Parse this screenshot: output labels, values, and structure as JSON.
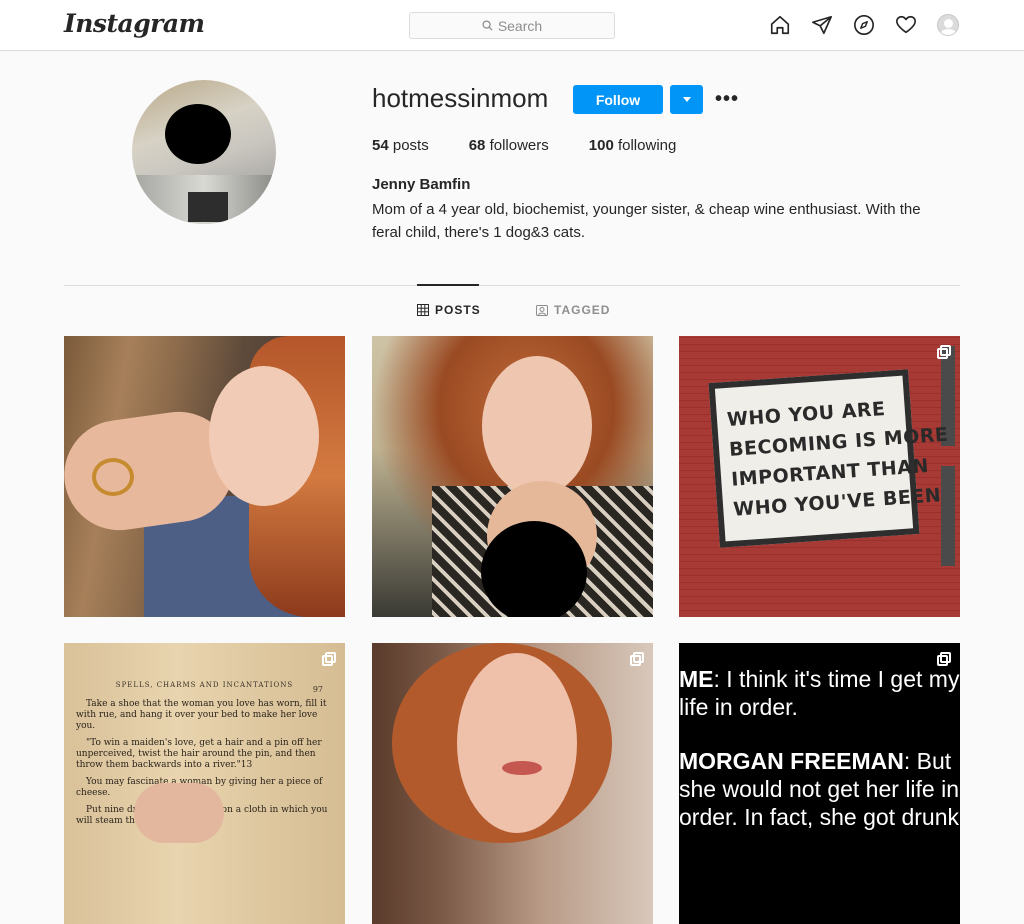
{
  "header": {
    "logo": "Instagram",
    "search_placeholder": "Search",
    "nav_icons": [
      "home-icon",
      "direct-icon",
      "explore-icon",
      "activity-heart-icon",
      "profile-avatar"
    ]
  },
  "profile": {
    "username": "hotmessinmom",
    "follow_label": "Follow",
    "more_label": "•••",
    "stats": {
      "posts_count": "54",
      "posts_label": "posts",
      "followers_count": "68",
      "followers_label": "followers",
      "following_count": "100",
      "following_label": "following"
    },
    "full_name": "Jenny Bamfin",
    "bio": "Mom of a 4 year old, biochemist, younger sister, & cheap wine enthusiast. With the feral child, there's 1 dog&3 cats."
  },
  "tabs": {
    "posts": "POSTS",
    "tagged": "TAGGED"
  },
  "posts": {
    "sign_lines": [
      "WHO  YOU  ARE",
      "BECOMING IS MORE",
      "IMPORTANT  THAN",
      "WHO YOU'VE BEEN"
    ],
    "book_header": "SPELLS, CHARMS AND INCANTATIONS",
    "book_page": "97",
    "book_paragraphs": [
      "Take a shoe that the woman you love has worn, fill it with rue, and hang it over your bed to make her love you.",
      "\"To win a maiden's love, get a hair and a pin off her unperceived, twist the hair around the pin, and then throw them backwards into a river.\"13",
      "You may fascinate a woman by giving her a piece of cheese.",
      "Put nine drops of fresh blood on a cloth in which you will steam the ... you love."
    ],
    "meme_line1_bold": "ME",
    "meme_line1_rest": ": I think it's time I get my life in order.",
    "meme_line2_bold": "MORGAN FREEMAN",
    "meme_line2_rest": ": But she would not get her life in order. In fact, she got drunk"
  },
  "colors": {
    "accent": "#0095f6",
    "text": "#262626",
    "muted": "#8e8e8e",
    "border": "#dbdbdb"
  }
}
